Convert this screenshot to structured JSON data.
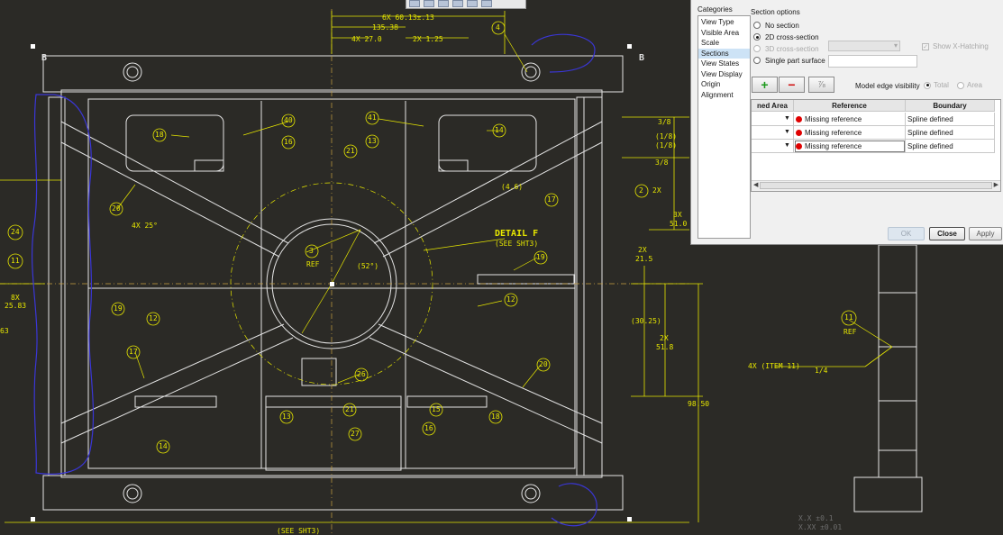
{
  "drawing": {
    "top_dim": "6X 60.13±.13",
    "dim_135": "135.38",
    "dim_4x27": "4X 27.0",
    "dim_2x1": "2X 1.25",
    "dim_378": "3/8",
    "dim_1116": "(1/8)",
    "dim_3x": "3X",
    "dim_51": "51.0",
    "dim_2x_a": "2X",
    "dim_215": "21.5",
    "dim_3025": "(30.25)",
    "dim_2x_b": "2X",
    "dim_518": "51.8",
    "dim_9850": "98.50",
    "dim_146": "(4.6)",
    "dim_4x25": "4X 25°",
    "dim_52": "(52°)",
    "dim_8x": "8X",
    "dim_2583": "25.83",
    "dim_3x_left": "3X",
    "dim_left_sm": "63",
    "detail_label": "DETAIL F",
    "detail_sub": "(SEE SHT3)",
    "see_sht3_bottom": "(SEE SHT3)",
    "ref_3": "REF",
    "ref_11": "REF",
    "item11": "4X (ITEM 11)",
    "frac": "1/4",
    "section_b_left": "B",
    "section_b_right": "B",
    "tol_xx": "X.X   ±0.1",
    "tol_xxx": "X.XX  ±0.01",
    "balloons": [
      "4",
      "18",
      "40",
      "41",
      "16",
      "13",
      "14",
      "14",
      "21",
      "2",
      "2X",
      "20",
      "17",
      "3",
      "19",
      "12",
      "12",
      "11",
      "19",
      "12",
      "26",
      "20",
      "17",
      "13",
      "21",
      "15",
      "18",
      "27",
      "16",
      "14",
      "24",
      "11",
      "11"
    ]
  },
  "dialog": {
    "categories_label": "Categories",
    "categories": [
      "View Type",
      "Visible Area",
      "Scale",
      "Sections",
      "View States",
      "View Display",
      "Origin",
      "Alignment"
    ],
    "selected_category": "Sections",
    "section_options_label": "Section options",
    "options": {
      "no_section": "No section",
      "cross_2d": "2D cross-section",
      "cross_3d": "3D cross-section",
      "single_part": "Single part surface"
    },
    "show_x_hatching": "Show X-Hatching",
    "toolbar": {
      "add": "+",
      "remove": "−",
      "flip": "⅞"
    },
    "model_edge_visibility": "Model edge visibility",
    "edge_total": "Total",
    "edge_area": "Area",
    "table": {
      "headers": [
        "ned Area",
        "Reference",
        "Boundary"
      ],
      "rows": [
        {
          "reference": "Missing reference",
          "boundary": "Spline defined"
        },
        {
          "reference": "Missing reference",
          "boundary": "Spline defined"
        },
        {
          "reference": "Missing reference",
          "boundary": "Spline defined"
        }
      ]
    },
    "buttons": {
      "ok": "OK",
      "close": "Close",
      "apply": "Apply"
    }
  },
  "colors": {
    "background": "#2b2a26",
    "geometry": "#e8e8e8",
    "dimension": "#e6e600",
    "sketch": "#3636d8",
    "error_dot": "#e00000"
  }
}
